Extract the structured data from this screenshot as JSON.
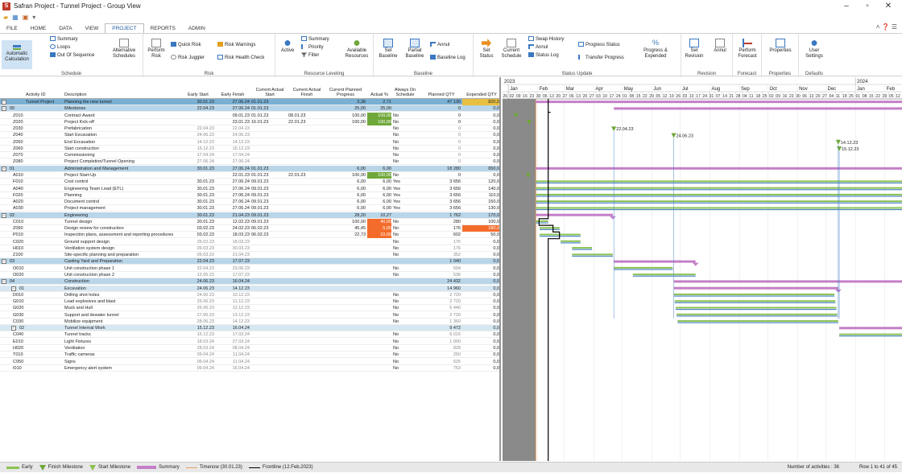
{
  "window": {
    "title": "Safran Project - Tunnel Project - Group View"
  },
  "tabs": [
    {
      "label": "FILE"
    },
    {
      "label": "HOME"
    },
    {
      "label": "DATA"
    },
    {
      "label": "VIEW"
    },
    {
      "label": "PROJECT",
      "active": true
    },
    {
      "label": "REPORTS"
    },
    {
      "label": "ADMIN"
    }
  ],
  "ribbon": {
    "schedule": {
      "label": "Schedule",
      "auto_calc": "Automatic Calculation",
      "summary": "Summary",
      "loops": "Loops",
      "out_of_sequence": "Out Of Sequence",
      "alt_schedules": "Alternative Schedules"
    },
    "risk": {
      "label": "Risk",
      "perform_risk": "Perform Risk",
      "quick_risk": "Quick Risk",
      "risk_juggler": "Risk Juggler",
      "risk_warnings": "Risk Warnings",
      "risk_health": "Risk Health Check"
    },
    "resource": {
      "label": "Resource Leveling",
      "active": "Active",
      "summary": "Summary",
      "priority": "Priority",
      "filter": "Filter",
      "available": "Available Resources"
    },
    "baseline": {
      "label": "Baseline",
      "set": "Set Baseline",
      "partial": "Partial Baseline",
      "annul": "Annul",
      "log": "Baseline Log"
    },
    "status": {
      "label": "Status Update",
      "set_status": "Set Status",
      "current_schedule": "Current Schedule",
      "swap_history": "Swap History",
      "annul": "Annul",
      "status_log": "Status Log",
      "progress_status": "Progress Status",
      "transfer_progress": "Transfer Progress",
      "progress_expended": "Progress & Expended"
    },
    "revision": {
      "label": "Revision",
      "set_revision": "Set Revision",
      "annul": "Annul"
    },
    "forecast": {
      "label": "Forecast",
      "perform_forecast": "Perform Forecast"
    },
    "properties": {
      "label": "Properties",
      "properties": "Properties"
    },
    "defaults": {
      "label": "Defaults",
      "user_settings": "User Settings"
    }
  },
  "columns": [
    "Activity ID",
    "Description",
    "Early Start",
    "Early Finish",
    "Current Actual Start",
    "Current Actual Finish",
    "Current Planned Progress",
    "Actual %",
    "Always On Schedule",
    "Planned QTY",
    "Expended QTY"
  ],
  "rows": [
    {
      "lvl": 0,
      "id": "Tunnel Project",
      "desc": "Planning the new tunnel",
      "es": "30.01.23",
      "ef": "27.06.24",
      "as": "01.01.23",
      "af": "",
      "cp": "3,38",
      "ap": "2,71",
      "aos": "",
      "pq": "47 130",
      "eq": "820,0"
    },
    {
      "lvl": 1,
      "id": "00",
      "desc": "Milestones",
      "es": "22.04.23",
      "ef": "27.06.24",
      "as": "01.01.23",
      "af": "",
      "cp": "25,00",
      "ap": "25,00",
      "aos": "",
      "pq": "0",
      "eq": "0,0"
    },
    {
      "lvl": 9,
      "id": "Z010",
      "desc": "Contract Award",
      "es": "",
      "ef": "09.01.23",
      "as": "01.01.23",
      "af": "08.01.23",
      "cp": "100,00",
      "ap": "100,00",
      "aos": "No",
      "pq": "0",
      "eq": "0,0",
      "hl": "green"
    },
    {
      "lvl": 9,
      "id": "Z020",
      "desc": "Project Kick-off",
      "es": "",
      "ef": "23.01.23",
      "as": "16.01.23",
      "af": "22.01.23",
      "cp": "100,00",
      "ap": "100,00",
      "aos": "No",
      "pq": "0",
      "eq": "0,0",
      "hl": "green"
    },
    {
      "lvl": 9,
      "id": "Z030",
      "desc": "Prefabrication",
      "es": "22.04.23",
      "ef": "22.04.23",
      "as": "",
      "af": "",
      "cp": "",
      "ap": "",
      "aos": "No",
      "pq": "0",
      "eq": "0,0"
    },
    {
      "lvl": 9,
      "id": "Z040",
      "desc": "Start Excavation",
      "es": "24.06.23",
      "ef": "24.06.23",
      "as": "",
      "af": "",
      "cp": "",
      "ap": "",
      "aos": "No",
      "pq": "0",
      "eq": "0,0"
    },
    {
      "lvl": 9,
      "id": "Z050",
      "desc": "End Excavation",
      "es": "14.12.23",
      "ef": "14.12.23",
      "as": "",
      "af": "",
      "cp": "",
      "ap": "",
      "aos": "No",
      "pq": "0",
      "eq": "0,0"
    },
    {
      "lvl": 9,
      "id": "Z060",
      "desc": "Start construction",
      "es": "15.12.23",
      "ef": "15.12.23",
      "as": "",
      "af": "",
      "cp": "",
      "ap": "",
      "aos": "No",
      "pq": "0",
      "eq": "0,0"
    },
    {
      "lvl": 9,
      "id": "Z070",
      "desc": "Commissioning",
      "es": "17.04.24",
      "ef": "17.04.24",
      "as": "",
      "af": "",
      "cp": "",
      "ap": "",
      "aos": "No",
      "pq": "0",
      "eq": "0,0"
    },
    {
      "lvl": 9,
      "id": "Z080",
      "desc": "Project Completion/Tunnel Opening",
      "es": "27.06.24",
      "ef": "27.06.24",
      "as": "",
      "af": "",
      "cp": "",
      "ap": "",
      "aos": "No",
      "pq": "0",
      "eq": "0,0"
    },
    {
      "lvl": 1,
      "id": "01",
      "desc": "Administration and Management",
      "es": "30.01.23",
      "ef": "27.06.24",
      "as": "01.01.23",
      "af": "",
      "cp": "6,00",
      "ap": "6,00",
      "aos": "",
      "pq": "18 280",
      "eq": "650,0"
    },
    {
      "lvl": 9,
      "id": "A010",
      "desc": "Project Start-Up",
      "es": "",
      "ef": "22.01.23",
      "as": "01.01.23",
      "af": "22.01.23",
      "cp": "100,00",
      "ap": "100,00",
      "aos": "No",
      "pq": "0",
      "eq": "0,0",
      "hl": "green"
    },
    {
      "lvl": 9,
      "id": "F010",
      "desc": "Cost control",
      "es": "30.01.23",
      "ef": "27.06.24",
      "as": "09.01.23",
      "af": "",
      "cp": "6,00",
      "ap": "6,00",
      "aos": "Yes",
      "pq": "3 656",
      "eq": "120,0"
    },
    {
      "lvl": 9,
      "id": "A040",
      "desc": "Engineering Team Lead (ETL)",
      "es": "30.01.23",
      "ef": "27.06.24",
      "as": "09.01.23",
      "af": "",
      "cp": "6,00",
      "ap": "6,00",
      "aos": "Yes",
      "pq": "3 656",
      "eq": "140,0"
    },
    {
      "lvl": 9,
      "id": "F020",
      "desc": "Planning",
      "es": "30.01.23",
      "ef": "27.06.24",
      "as": "09.01.23",
      "af": "",
      "cp": "6,00",
      "ap": "6,00",
      "aos": "Yes",
      "pq": "3 656",
      "eq": "110,0"
    },
    {
      "lvl": 9,
      "id": "A020",
      "desc": "Document control",
      "es": "30.01.23",
      "ef": "27.06.24",
      "as": "09.01.23",
      "af": "",
      "cp": "6,00",
      "ap": "6,00",
      "aos": "Yes",
      "pq": "3 656",
      "eq": "150,0"
    },
    {
      "lvl": 9,
      "id": "A030",
      "desc": "Project management",
      "es": "30.01.23",
      "ef": "27.06.24",
      "as": "09.01.23",
      "af": "",
      "cp": "6,00",
      "ap": "6,00",
      "aos": "Yes",
      "pq": "3 656",
      "eq": "130,0"
    },
    {
      "lvl": 1,
      "id": "02",
      "desc": "Engineering",
      "es": "30.01.23",
      "ef": "21.04.23",
      "as": "09.01.23",
      "af": "",
      "cp": "28,20",
      "ap": "10,27",
      "aos": "",
      "pq": "1 762",
      "eq": "170,0"
    },
    {
      "lvl": 9,
      "id": "C010",
      "desc": "Tunnel design",
      "es": "30.01.23",
      "ef": "12.02.23",
      "as": "09.01.23",
      "af": "",
      "cp": "100,00",
      "ap": "40,00",
      "aos": "No",
      "pq": "280",
      "eq": "100,0",
      "hl": "orange"
    },
    {
      "lvl": 9,
      "id": "Z090",
      "desc": "Design review for construction",
      "es": "03.02.23",
      "ef": "24.02.23",
      "as": "06.02.23",
      "af": "",
      "cp": "45,45",
      "ap": "5,00",
      "aos": "No",
      "pq": "176",
      "eq": "180,0",
      "hl": "orange",
      "hl2": true
    },
    {
      "lvl": 9,
      "id": "P010",
      "desc": "Inspection plans, assessment and reporting procedures",
      "es": "03.02.23",
      "ef": "18.03.23",
      "as": "06.02.23",
      "af": "",
      "cp": "22,73",
      "ap": "10,00",
      "aos": "No",
      "pq": "602",
      "eq": "50,0",
      "hl": "orange"
    },
    {
      "lvl": 9,
      "id": "C020",
      "desc": "Ground support design",
      "es": "25.02.23",
      "ef": "18.03.23",
      "as": "",
      "af": "",
      "cp": "",
      "ap": "",
      "aos": "No",
      "pq": "176",
      "eq": "0,0"
    },
    {
      "lvl": 9,
      "id": "H010",
      "desc": "Ventilation system design",
      "es": "09.03.23",
      "ef": "30.03.23",
      "as": "",
      "af": "",
      "cp": "",
      "ap": "",
      "aos": "No",
      "pq": "176",
      "eq": "0,0"
    },
    {
      "lvl": 9,
      "id": "Z100",
      "desc": "Site-specific planning and preparation",
      "es": "09.03.23",
      "ef": "21.04.23",
      "as": "",
      "af": "",
      "cp": "",
      "ap": "",
      "aos": "No",
      "pq": "352",
      "eq": "0,0"
    },
    {
      "lvl": 1,
      "id": "03",
      "desc": "Casting Yard and Preparation",
      "es": "22.04.23",
      "ef": "17.07.23",
      "as": "",
      "af": "",
      "cp": "",
      "ap": "",
      "aos": "",
      "pq": "1 040",
      "eq": "0,0"
    },
    {
      "lvl": 9,
      "id": "O010",
      "desc": "Unit construction phase 1",
      "es": "22.04.23",
      "ef": "23.06.23",
      "as": "",
      "af": "",
      "cp": "",
      "ap": "",
      "aos": "No",
      "pq": "504",
      "eq": "0,0"
    },
    {
      "lvl": 9,
      "id": "O020",
      "desc": "Unit construction phase 2",
      "es": "12.05.23",
      "ef": "17.07.23",
      "as": "",
      "af": "",
      "cp": "",
      "ap": "",
      "aos": "No",
      "pq": "536",
      "eq": "0,0"
    },
    {
      "lvl": 1,
      "id": "04",
      "desc": "Construction",
      "es": "24.06.23",
      "ef": "16.04.24",
      "as": "",
      "af": "",
      "cp": "",
      "ap": "",
      "aos": "",
      "pq": "24 432",
      "eq": "0,0"
    },
    {
      "lvl": 2,
      "id": "01",
      "desc": "Excavation",
      "es": "24.06.23",
      "ef": "14.12.23",
      "as": "",
      "af": "",
      "cp": "",
      "ap": "",
      "aos": "",
      "pq": "14 960",
      "eq": "0,0"
    },
    {
      "lvl": 9,
      "id": "D010",
      "desc": "Drilling shot holes",
      "es": "24.06.23",
      "ef": "10.12.23",
      "as": "",
      "af": "",
      "cp": "",
      "ap": "",
      "aos": "No",
      "pq": "2 720",
      "eq": "0,0"
    },
    {
      "lvl": 9,
      "id": "G010",
      "desc": "Load explosives and blast",
      "es": "25.06.23",
      "ef": "11.12.23",
      "as": "",
      "af": "",
      "cp": "",
      "ap": "",
      "aos": "No",
      "pq": "2 720",
      "eq": "0,0"
    },
    {
      "lvl": 9,
      "id": "G020",
      "desc": "Muck and Hull",
      "es": "26.06.23",
      "ef": "12.12.23",
      "as": "",
      "af": "",
      "cp": "",
      "ap": "",
      "aos": "No",
      "pq": "5 440",
      "eq": "0,0"
    },
    {
      "lvl": 9,
      "id": "G030",
      "desc": "Support and dewater tunnel",
      "es": "27.06.23",
      "ef": "13.12.23",
      "as": "",
      "af": "",
      "cp": "",
      "ap": "",
      "aos": "No",
      "pq": "2 720",
      "eq": "0,0"
    },
    {
      "lvl": 9,
      "id": "C030",
      "desc": "Mobilize equipment",
      "es": "28.06.23",
      "ef": "14.12.23",
      "as": "",
      "af": "",
      "cp": "",
      "ap": "",
      "aos": "No",
      "pq": "1 360",
      "eq": "0,0"
    },
    {
      "lvl": 2,
      "id": "02",
      "desc": "Tunnel Internal Work",
      "es": "15.12.23",
      "ef": "16.04.24",
      "as": "",
      "af": "",
      "cp": "",
      "ap": "",
      "aos": "",
      "pq": "9 472",
      "eq": "0,0"
    },
    {
      "lvl": 9,
      "id": "C040",
      "desc": "Tunnel tracks",
      "es": "15.12.23",
      "ef": "17.03.24",
      "as": "",
      "af": "",
      "cp": "",
      "ap": "",
      "aos": "No",
      "pq": "6 016",
      "eq": "0,0"
    },
    {
      "lvl": 9,
      "id": "E010",
      "desc": "Light Fixtures",
      "es": "18.03.24",
      "ef": "27.03.24",
      "as": "",
      "af": "",
      "cp": "",
      "ap": "",
      "aos": "No",
      "pq": "1 000",
      "eq": "0,0"
    },
    {
      "lvl": 9,
      "id": "H020",
      "desc": "Ventilation",
      "es": "28.03.24",
      "ef": "08.04.24",
      "as": "",
      "af": "",
      "cp": "",
      "ap": "",
      "aos": "No",
      "pq": "828",
      "eq": "0,0"
    },
    {
      "lvl": 9,
      "id": "T010",
      "desc": "Traffic cameras",
      "es": "09.04.24",
      "ef": "11.04.24",
      "as": "",
      "af": "",
      "cp": "",
      "ap": "",
      "aos": "No",
      "pq": "250",
      "eq": "0,0"
    },
    {
      "lvl": 9,
      "id": "C050",
      "desc": "Signs",
      "es": "09.04.24",
      "ef": "11.04.24",
      "as": "",
      "af": "",
      "cp": "",
      "ap": "",
      "aos": "No",
      "pq": "625",
      "eq": "0,0"
    },
    {
      "lvl": 9,
      "id": "I010",
      "desc": "Emergency alert system",
      "es": "09.04.24",
      "ef": "16.04.24",
      "as": "",
      "af": "",
      "cp": "",
      "ap": "",
      "aos": "No",
      "pq": "753",
      "eq": "0,0"
    }
  ],
  "gantt": {
    "years": [
      "2023",
      "2024"
    ],
    "months": [
      "Jan",
      "Feb",
      "Mar",
      "Apr",
      "May",
      "Jun",
      "Jul",
      "Aug",
      "Sep",
      "Oct",
      "Nov",
      "Dec",
      "Jan",
      "Feb"
    ],
    "weeks": [
      "26",
      "02",
      "09",
      "16",
      "23",
      "30",
      "06",
      "13",
      "20",
      "27",
      "06",
      "13",
      "20",
      "27",
      "03",
      "10",
      "17",
      "24",
      "01",
      "08",
      "15",
      "22",
      "29",
      "05",
      "12",
      "19",
      "26",
      "03",
      "10",
      "17",
      "24",
      "31",
      "07",
      "14",
      "21",
      "28",
      "04",
      "11",
      "18",
      "25",
      "02",
      "09",
      "16",
      "23",
      "30",
      "06",
      "13",
      "20",
      "27",
      "04",
      "11",
      "18",
      "25",
      "01",
      "08",
      "15",
      "22",
      "29",
      "05",
      "12"
    ],
    "labels": {
      "z030": "22.04.23",
      "z040": "24.06.23",
      "z050": "14.12.23",
      "z060": "15.12.23"
    }
  },
  "status": {
    "early": "Early",
    "finish_ms": "Finish Milestone",
    "start_ms": "Start Milestone",
    "summary": "Summary",
    "timenow": "Timenow (30.01.23)",
    "frontline": "Frontline (12.Feb.2023)",
    "count": "Number of activities : 36",
    "rows": "Row 1 to 41 of 45"
  },
  "colors": {
    "accent": "#1e5aa0",
    "summary": "#c47fc7",
    "early": "#8cc152",
    "baseline": "#4a86c8",
    "orange": "#f46c2c",
    "green": "#6fa83a"
  }
}
